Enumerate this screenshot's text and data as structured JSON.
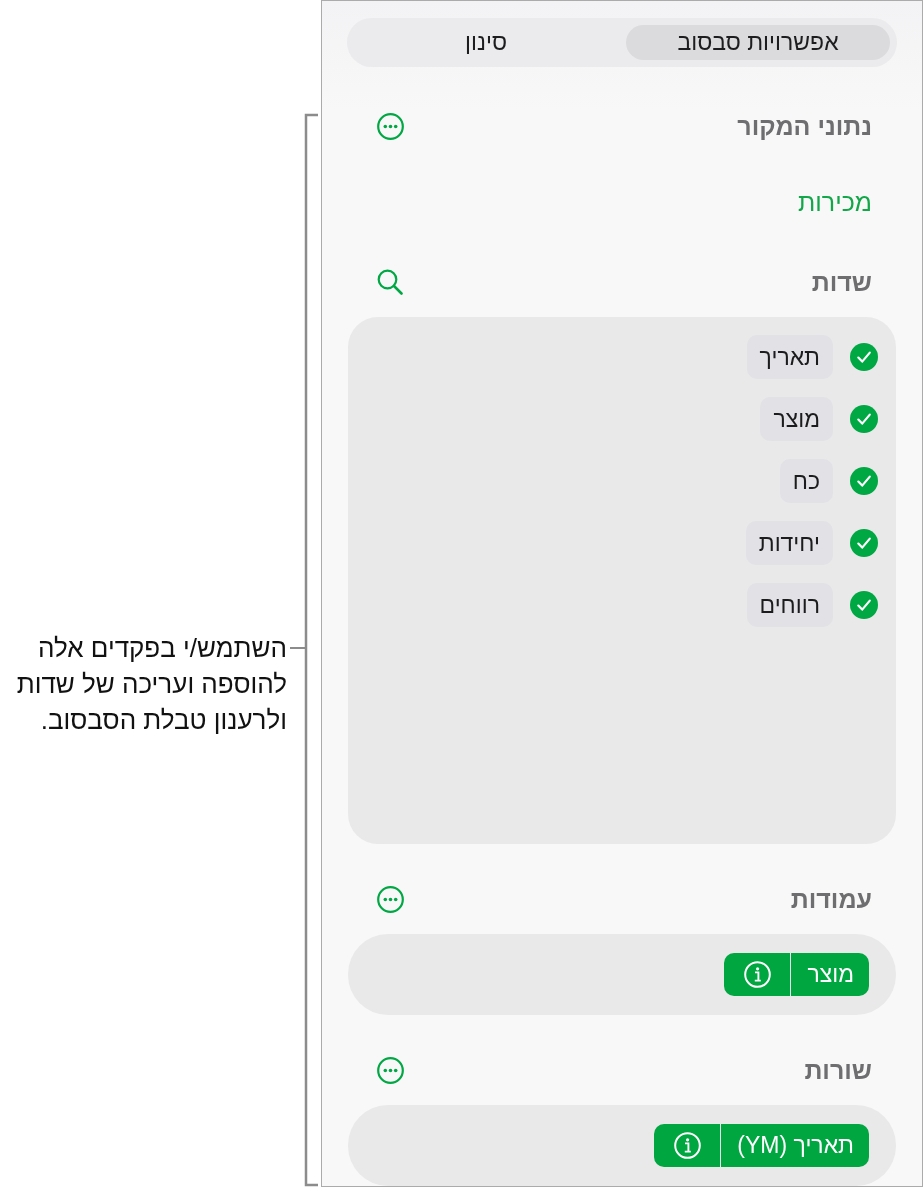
{
  "segmented_control": {
    "tabs": [
      {
        "label": "אפשרויות סבסוב",
        "selected": true
      },
      {
        "label": "סינון",
        "selected": false
      }
    ]
  },
  "sections": [
    {
      "kind": "source",
      "title": "נתוני המקור",
      "value": "מכירות"
    },
    {
      "kind": "fields",
      "title": "שדות",
      "fields": [
        {
          "label": "תאריך",
          "checked": true
        },
        {
          "label": "מוצר",
          "checked": true
        },
        {
          "label": "כח",
          "checked": true
        },
        {
          "label": "יחידות",
          "checked": true
        },
        {
          "label": "רווחים",
          "checked": true
        }
      ]
    },
    {
      "kind": "chips",
      "title": "עמודות",
      "chips": [
        {
          "label": "מוצר"
        }
      ]
    },
    {
      "kind": "chips",
      "title": "שורות",
      "chips": [
        {
          "label": "תאריך (YM)"
        }
      ]
    }
  ],
  "callout": {
    "text": "השתמש/י בפקדים אלה להוספה ועריכה של שדות ולרענון טבלת הסבסוב."
  }
}
